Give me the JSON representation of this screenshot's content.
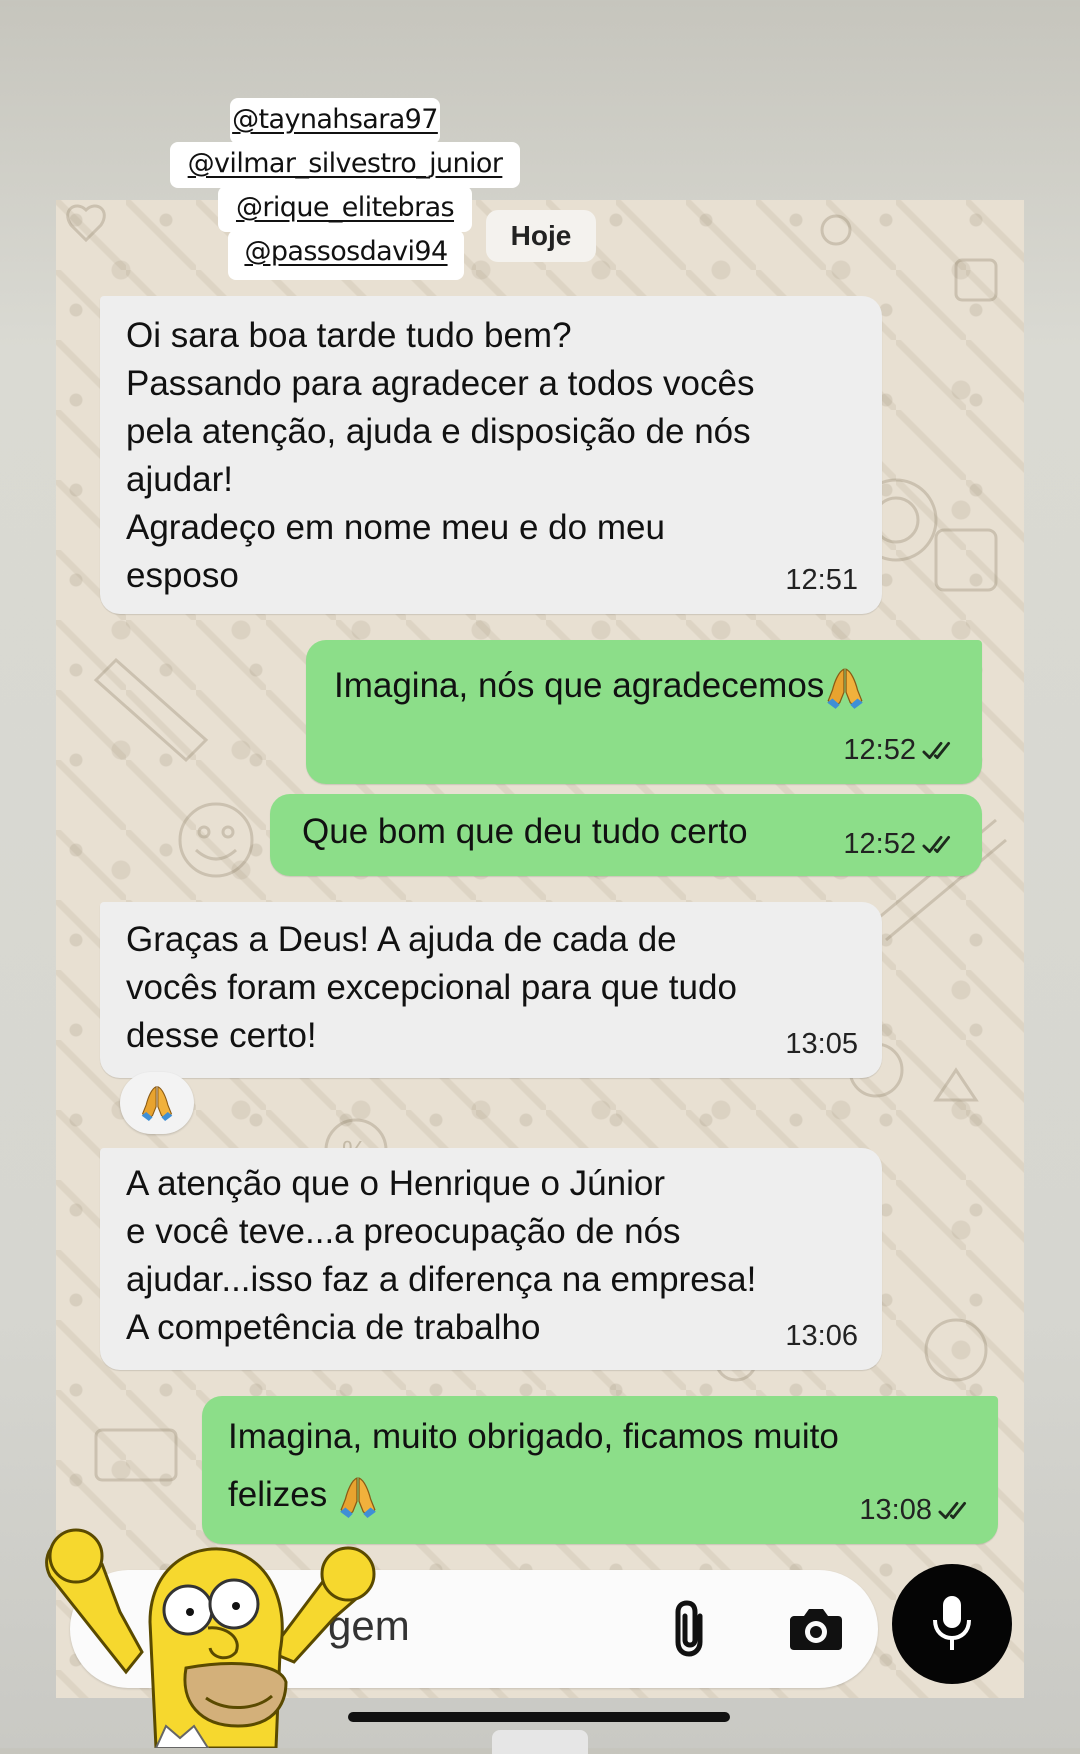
{
  "story_tags": [
    "@taynahsara97",
    "@vilmar_silvestro_junior",
    "@rique_elitebras",
    "@passosdavi94"
  ],
  "date_separator": "Hoje",
  "messages": [
    {
      "direction": "in",
      "text": "Oi sara boa tarde tudo bem?\nPassando para agradecer a todos vocês\npela atenção, ajuda e disposição de nós\najudar!\nAgradeço em nome meu e do meu\nesposo",
      "time": "12:51"
    },
    {
      "direction": "out",
      "text": "Imagina, nós que agradecemos",
      "emoji": "folded-hands",
      "time": "12:52",
      "status": "read"
    },
    {
      "direction": "out",
      "text": "Que bom que deu tudo certo",
      "time": "12:52",
      "status": "read"
    },
    {
      "direction": "in",
      "text": "Graças a Deus! A ajuda de cada de\nvocês foram excepcional para que tudo\ndesse certo!",
      "time": "13:05",
      "reaction": "folded-hands"
    },
    {
      "direction": "in",
      "text": "A atenção que o Henrique o Júnior\ne você teve...a preocupação de nós\najudar...isso faz a diferença na empresa!\nA competência de trabalho",
      "time": "13:06"
    },
    {
      "direction": "out",
      "text": "Imagina, muito obrigado, ficamos muito\nfelizes",
      "emoji": "folded-hands",
      "time": "13:08",
      "status": "read"
    }
  ],
  "composer": {
    "placeholder_visible": "gem"
  },
  "icons": [
    "paperclip-icon",
    "camera-icon",
    "microphone-icon",
    "double-check-icon",
    "folded-hands-emoji",
    "homer-sticker"
  ],
  "colors": {
    "incoming_bubble": "#eeeeee",
    "outgoing_bubble": "#8cde89",
    "mic_button": "#050505",
    "chat_wallpaper": "#e8e0d2"
  }
}
